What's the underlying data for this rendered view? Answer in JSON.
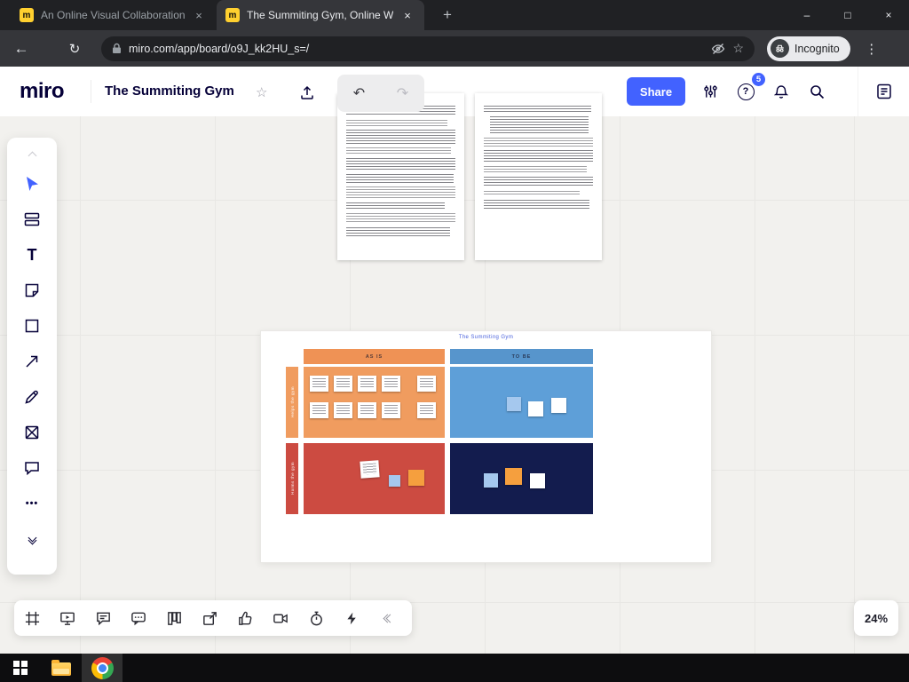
{
  "colors": {
    "accent-blue": "#4262ff",
    "tab-strip-bg": "#202124",
    "toolbar-bg": "#35363a",
    "canvas-bg": "#f2f1ee",
    "quad-orange": "#f09c5f",
    "quad-orange-header": "#ef9255",
    "quad-blue": "#5e9fd8",
    "quad-blue-header": "#5795cc",
    "quad-red": "#cc4b41",
    "quad-navy": "#131c4e",
    "sticky-white": "#ffffff",
    "sticky-blue": "#a5c8ee",
    "sticky-orange": "#f59f3e"
  },
  "browser": {
    "tabs": [
      {
        "title": "An Online Visual Collaboration Pl"
      },
      {
        "title": "The Summiting Gym, Online Whi"
      }
    ],
    "url": "miro.com/app/board/o9J_kk2HU_s=/",
    "profile_label": "Incognito"
  },
  "header": {
    "logo": "miro",
    "board_title": "The Summiting Gym",
    "share_label": "Share",
    "help_badge_count": "5"
  },
  "board": {
    "frame_title": "The Summiting Gym",
    "matrix": {
      "col_headers": [
        "AS IS",
        "TO BE"
      ],
      "row_labels": [
        "Helps the gym",
        "Harms the gym"
      ]
    }
  },
  "controls": {
    "zoom_level": "24%"
  },
  "icons": {
    "favicon": "m",
    "close": "×",
    "plus": "+",
    "minimize": "–",
    "maximize": "□",
    "back": "←",
    "reload": "↻",
    "kebab": "⋮",
    "star": "☆",
    "undo": "↶",
    "redo": "↷",
    "text_tool": "T",
    "more": "•••",
    "help": "?"
  }
}
